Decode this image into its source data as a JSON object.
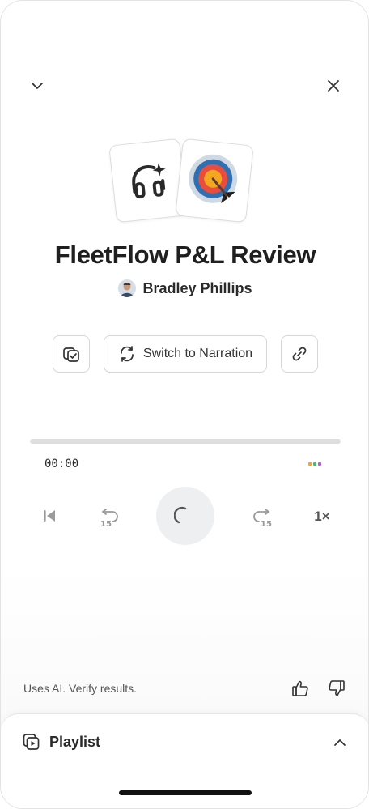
{
  "header": {
    "collapse_icon": "chevron-down-icon",
    "close_icon": "close-icon"
  },
  "cover": {
    "left_icon": "headphones-sparkle-icon",
    "right_icon": "target-dart-icon"
  },
  "episode": {
    "title": "FleetFlow P&L Review",
    "author": "Bradley Phillips"
  },
  "actions": {
    "copy_icon": "copy-check-icon",
    "switch_label": "Switch to Narration",
    "switch_icon": "refresh-icon",
    "link_icon": "link-icon"
  },
  "player": {
    "progress": 0,
    "time": "00:00",
    "speed": "1×",
    "skip_back_label": "15",
    "skip_forward_label": "15",
    "dot_colors": [
      "#f4a51c",
      "#3fbf6a",
      "#b45be0"
    ]
  },
  "footer": {
    "disclaimer": "Uses AI. Verify results.",
    "thumbs_up_icon": "thumbs-up-icon",
    "thumbs_down_icon": "thumbs-down-icon"
  },
  "playlist": {
    "label": "Playlist",
    "icon": "playlist-icon",
    "toggle_icon": "chevron-up-icon"
  }
}
